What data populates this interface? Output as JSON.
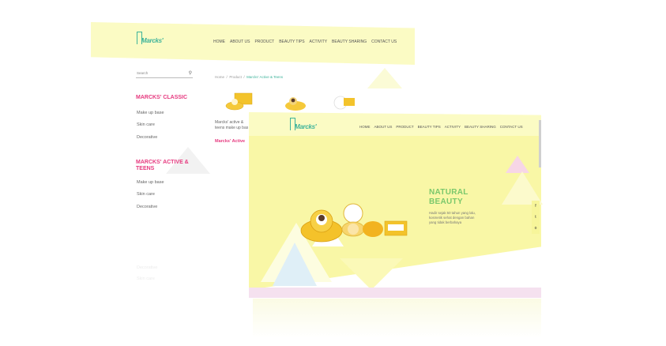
{
  "back_window": {
    "logo_text": "Marcks'",
    "nav": [
      "HOME",
      "ABOUT US",
      "PRODUCT",
      "BEAUTY TIPS",
      "ACTIVITY",
      "BEAUTY SHARING",
      "CONTACT US"
    ],
    "search_placeholder": "Search",
    "breadcrumb": {
      "home": "Home",
      "product": "Product",
      "current": "Marcks' Active & Teens"
    },
    "sidebar": {
      "classic_heading": "MARCKS' CLASSIC",
      "classic_items": [
        "Make up base",
        "Skin care",
        "Decorative"
      ],
      "teens_heading": "MARCKS' ACTIVE & TEENS",
      "teens_items": [
        "Make up base",
        "Skin care",
        "Decorative"
      ],
      "faded_items": [
        "Decorative",
        "Skin care"
      ]
    },
    "product_desc": [
      "Marcks' active &",
      "teens make up bas"
    ],
    "product_category": "Marcks' Active"
  },
  "front_window": {
    "logo_text": "Marcks'",
    "nav": [
      "HOME",
      "ABOUT US",
      "PRODUCT",
      "BEAUTY TIPS",
      "ACTIVITY",
      "BEAUTY SHARING",
      "CONTACT US"
    ],
    "hero_title_1": "NATURAL",
    "hero_title_2": "BEAUTY",
    "hero_text": "Hadir sejak 50 tahun yang lalu, kosmetik sehat dengan bahan yang tidak berbahaya",
    "social": [
      "f",
      "t",
      "o"
    ]
  },
  "colors": {
    "accent_green": "#3db39a",
    "accent_pink": "#e6397f",
    "yellow": "#f9f7a6",
    "header_yellow": "#fbfbc4"
  }
}
